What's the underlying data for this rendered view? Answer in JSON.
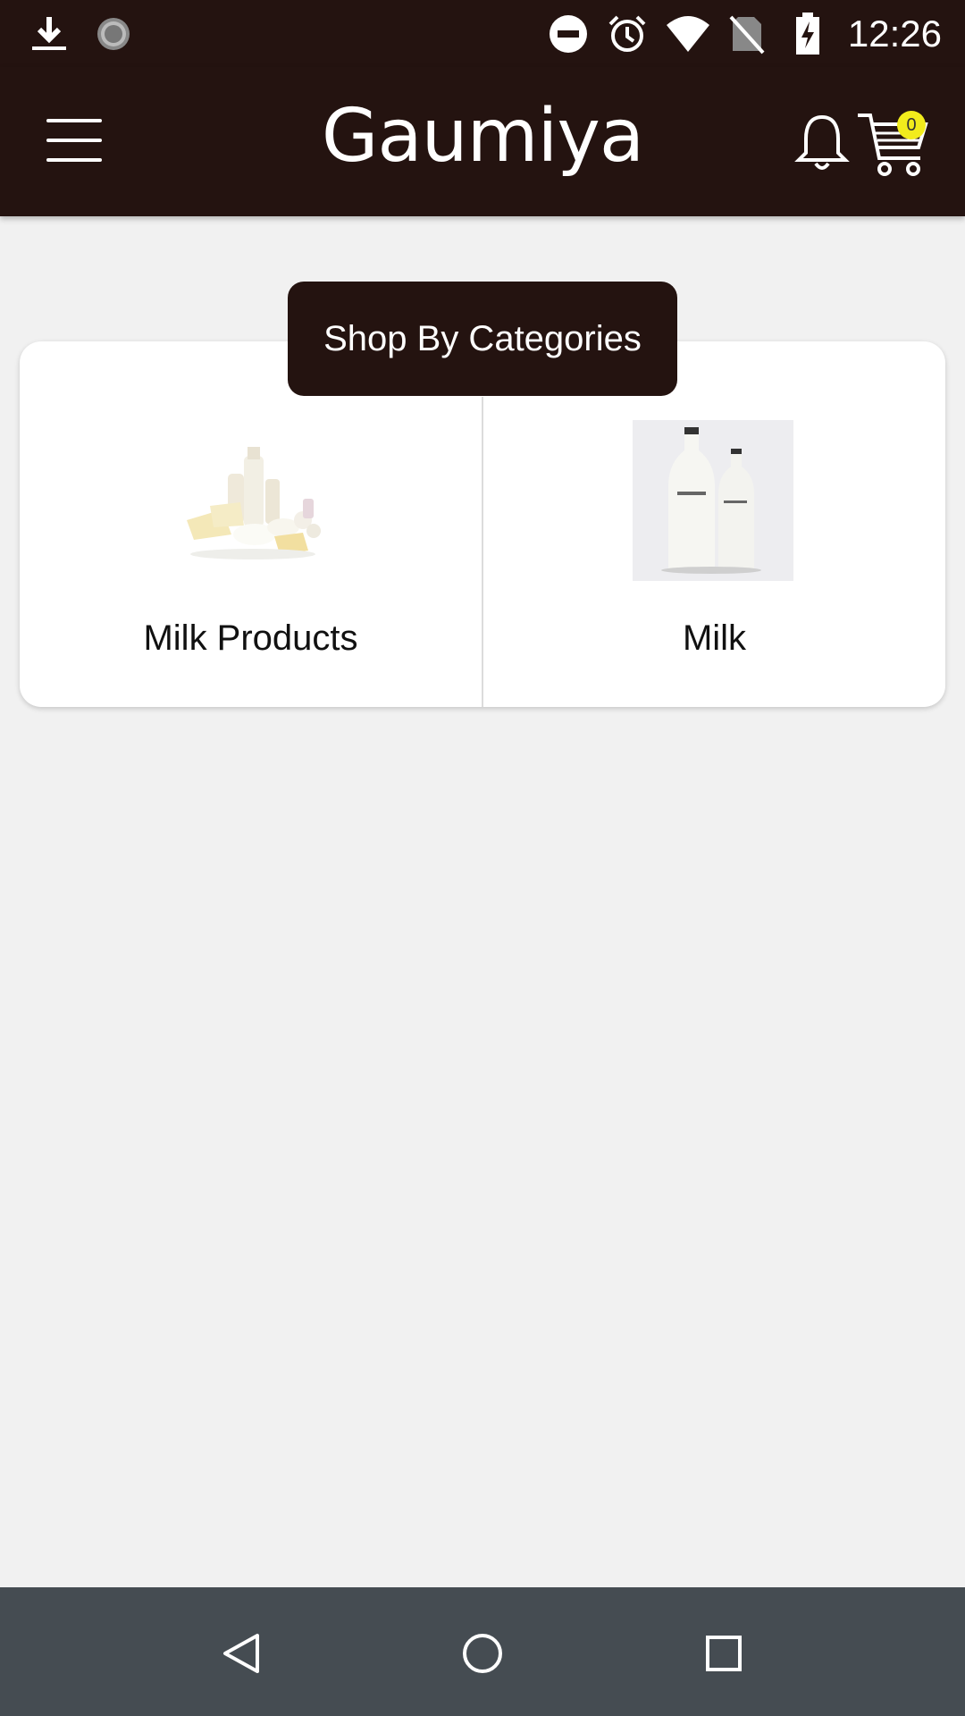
{
  "status_bar": {
    "time": "12:26",
    "icons": [
      "download-icon",
      "sync-spinner-icon",
      "do-not-disturb-icon",
      "alarm-icon",
      "wifi-icon",
      "no-sim-icon",
      "battery-charging-icon"
    ]
  },
  "app_bar": {
    "title": "Gaumiya",
    "menu_icon": "hamburger-menu-icon",
    "notification_icon": "bell-icon",
    "cart_icon": "shopping-cart-icon",
    "cart_count": "0"
  },
  "categories_section": {
    "header": "Shop By Categories",
    "items": [
      {
        "label": "Milk Products",
        "icon": "dairy-products-image"
      },
      {
        "label": "Milk",
        "icon": "milk-bottles-image"
      }
    ]
  },
  "nav_bar": {
    "icons": [
      "back-icon",
      "home-icon",
      "recents-icon"
    ]
  },
  "colors": {
    "app_bar": "#241310",
    "background": "#f1f1f1",
    "badge": "#f2ec1c",
    "nav_bar": "#454c52"
  }
}
